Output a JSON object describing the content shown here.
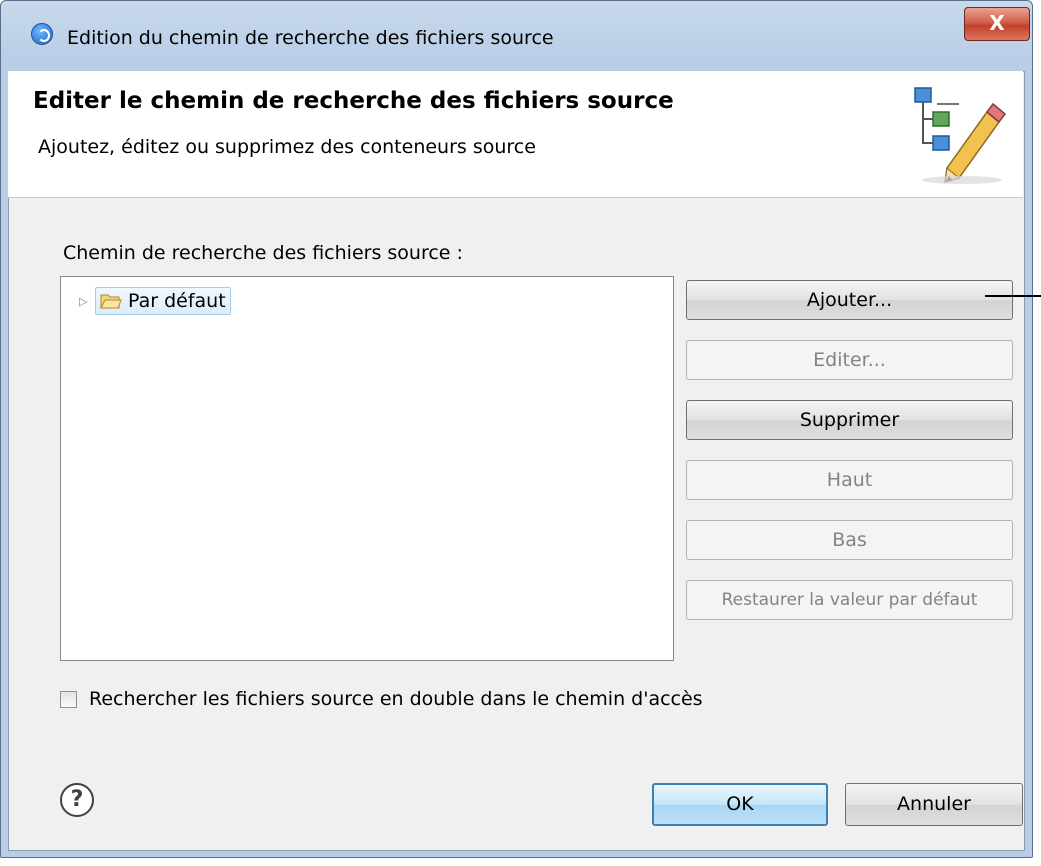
{
  "window": {
    "title": "Edition du chemin de recherche des fichiers source",
    "close_label": "X"
  },
  "banner": {
    "title": "Editer le chemin de recherche des fichiers source",
    "subtitle": "Ajoutez, éditez ou supprimez des conteneurs source"
  },
  "source_path": {
    "label": "Chemin de recherche des fichiers source :",
    "items": [
      {
        "label": "Par défaut",
        "expanded": false,
        "selected": true
      }
    ]
  },
  "buttons": {
    "add": "Ajouter...",
    "edit": "Editer...",
    "remove": "Supprimer",
    "up": "Haut",
    "down": "Bas",
    "restore_default": "Restaurer la valeur par défaut"
  },
  "options": {
    "search_duplicates_label": "Rechercher les fichiers source en double dans le chemin d'accès",
    "search_duplicates_checked": false
  },
  "footer": {
    "help_symbol": "?",
    "ok": "OK",
    "cancel": "Annuler"
  },
  "colors": {
    "title_bar": "#b8cde6",
    "close_button": "#c2402a",
    "ok_border": "#3c7fb1",
    "selection": "#dcecfb"
  }
}
